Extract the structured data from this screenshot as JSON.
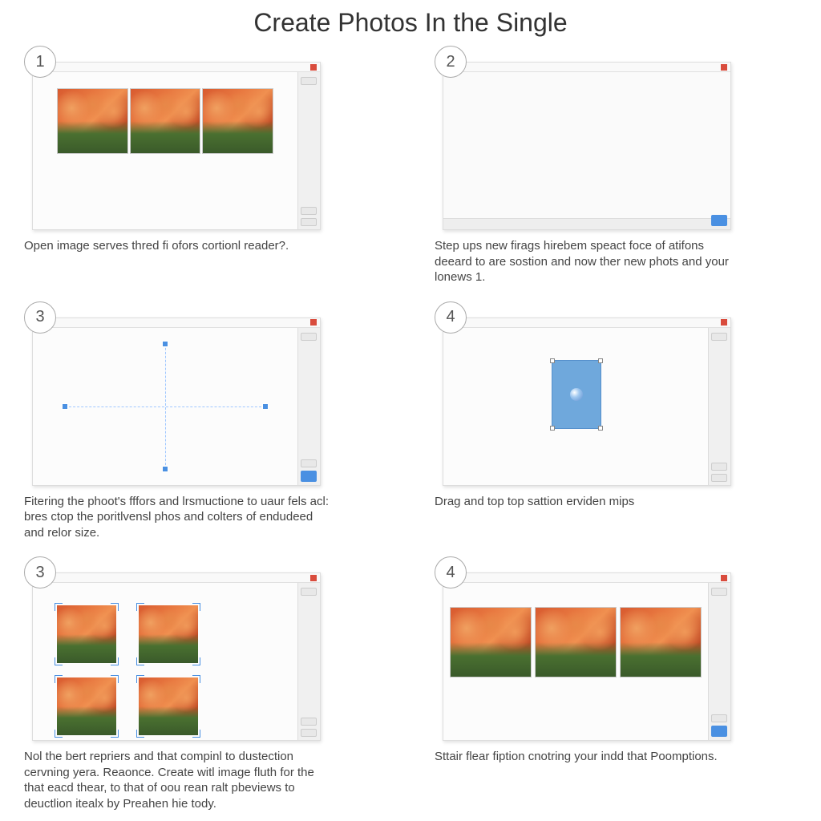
{
  "title": "Create Photos In the Single",
  "steps": [
    {
      "num": "1",
      "caption": "Open image serves thred fi ofors cortionl reader?."
    },
    {
      "num": "2",
      "caption": "Step ups new firags hirebem speact foce of atifons deeard to are sostion and now ther new phots and your lonews 1."
    },
    {
      "num": "3",
      "caption": "Fitering the phoot's fffors and lrsmuctione to uaur fels acl: bres ctop the poritlvensl phos and colters of endudeed and relor size."
    },
    {
      "num": "4",
      "caption": "Drag and top top sattion erviden mips"
    },
    {
      "num": "3",
      "caption": "Nol the bert repriers and that compinl to dustection cervning yera. Reaonce. Create witl image fluth for the that eacd thear, to that of oou rean ralt pbeviews to deuctlion itealx by Preahen hie tody."
    },
    {
      "num": "4",
      "caption": "Sttair flear fiption cnotring your indd that Poomptions."
    }
  ]
}
